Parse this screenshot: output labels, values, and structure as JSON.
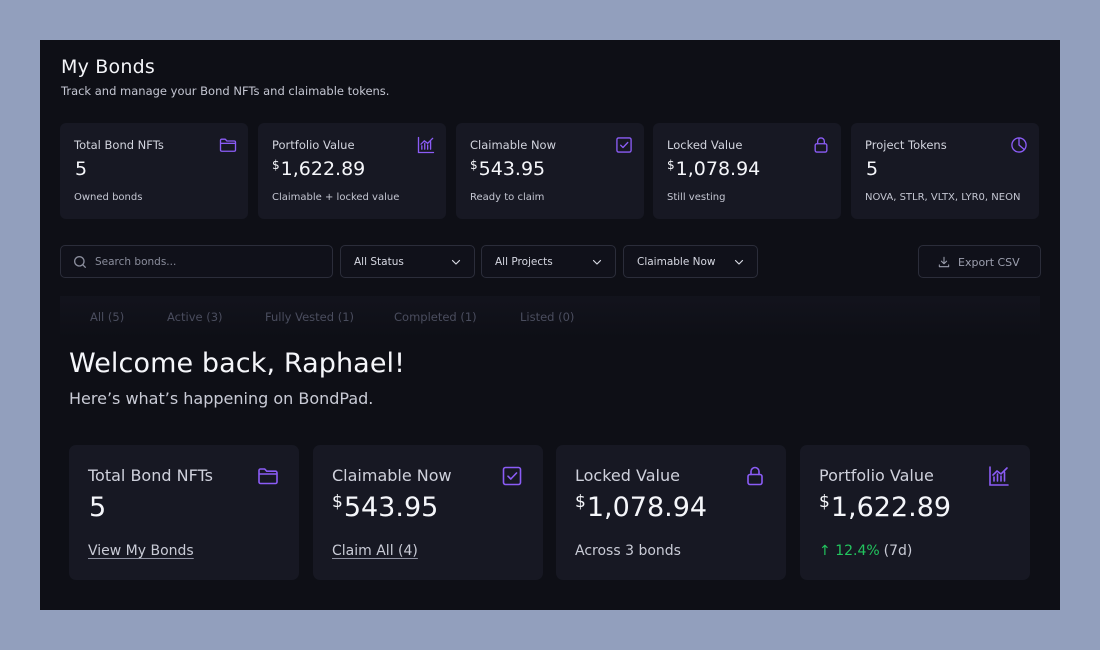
{
  "header": {
    "title": "My Bonds",
    "subtitle": "Track and manage your Bond NFTs and claimable tokens."
  },
  "stats": [
    {
      "label": "Total Bond NFTs",
      "currency": "",
      "value": "5",
      "sub": "Owned bonds",
      "icon": "folder-icon"
    },
    {
      "label": "Portfolio Value",
      "currency": "$",
      "value": "1,622.89",
      "sub": "Claimable + locked value",
      "icon": "chart-icon"
    },
    {
      "label": "Claimable Now",
      "currency": "$",
      "value": "543.95",
      "sub": "Ready to claim",
      "icon": "checkbox-icon"
    },
    {
      "label": "Locked Value",
      "currency": "$",
      "value": "1,078.94",
      "sub": "Still vesting",
      "icon": "lock-icon"
    },
    {
      "label": "Project Tokens",
      "currency": "",
      "value": "5",
      "sub": "NOVA, STLR, VLTX, LYR0, NEON",
      "icon": "pie-chart-icon"
    }
  ],
  "filters": {
    "search_placeholder": "Search bonds...",
    "status": "All Status",
    "projects": "All Projects",
    "sort": "Claimable Now",
    "export_label": "Export CSV"
  },
  "tabs": [
    {
      "label": "All (5)"
    },
    {
      "label": "Active (3)"
    },
    {
      "label": "Fully Vested (1)"
    },
    {
      "label": "Completed (1)"
    },
    {
      "label": "Listed (0)"
    }
  ],
  "welcome": {
    "title": "Welcome back, Raphael!",
    "subtitle": "Here’s what’s happening on BondPad."
  },
  "overview": [
    {
      "label": "Total Bond NFTs",
      "currency": "",
      "value": "5",
      "foot": "View My Bonds",
      "icon": "folder-icon"
    },
    {
      "label": "Claimable Now",
      "currency": "$",
      "value": "543.95",
      "foot": "Claim All (4)",
      "icon": "checkbox-icon"
    },
    {
      "label": "Locked Value",
      "currency": "$",
      "value": "1,078.94",
      "foot": "Across 3 bonds",
      "icon": "lock-icon"
    },
    {
      "label": "Portfolio Value",
      "currency": "$",
      "value": "1,622.89",
      "trend_arrow": "↑",
      "trend_value": "12.4%",
      "trend_period": "(7d)",
      "icon": "chart-icon"
    }
  ],
  "colors": {
    "accent": "#8b5cf6",
    "positive": "#22c55e",
    "card": "#171823",
    "panel": "#0e0f16"
  }
}
